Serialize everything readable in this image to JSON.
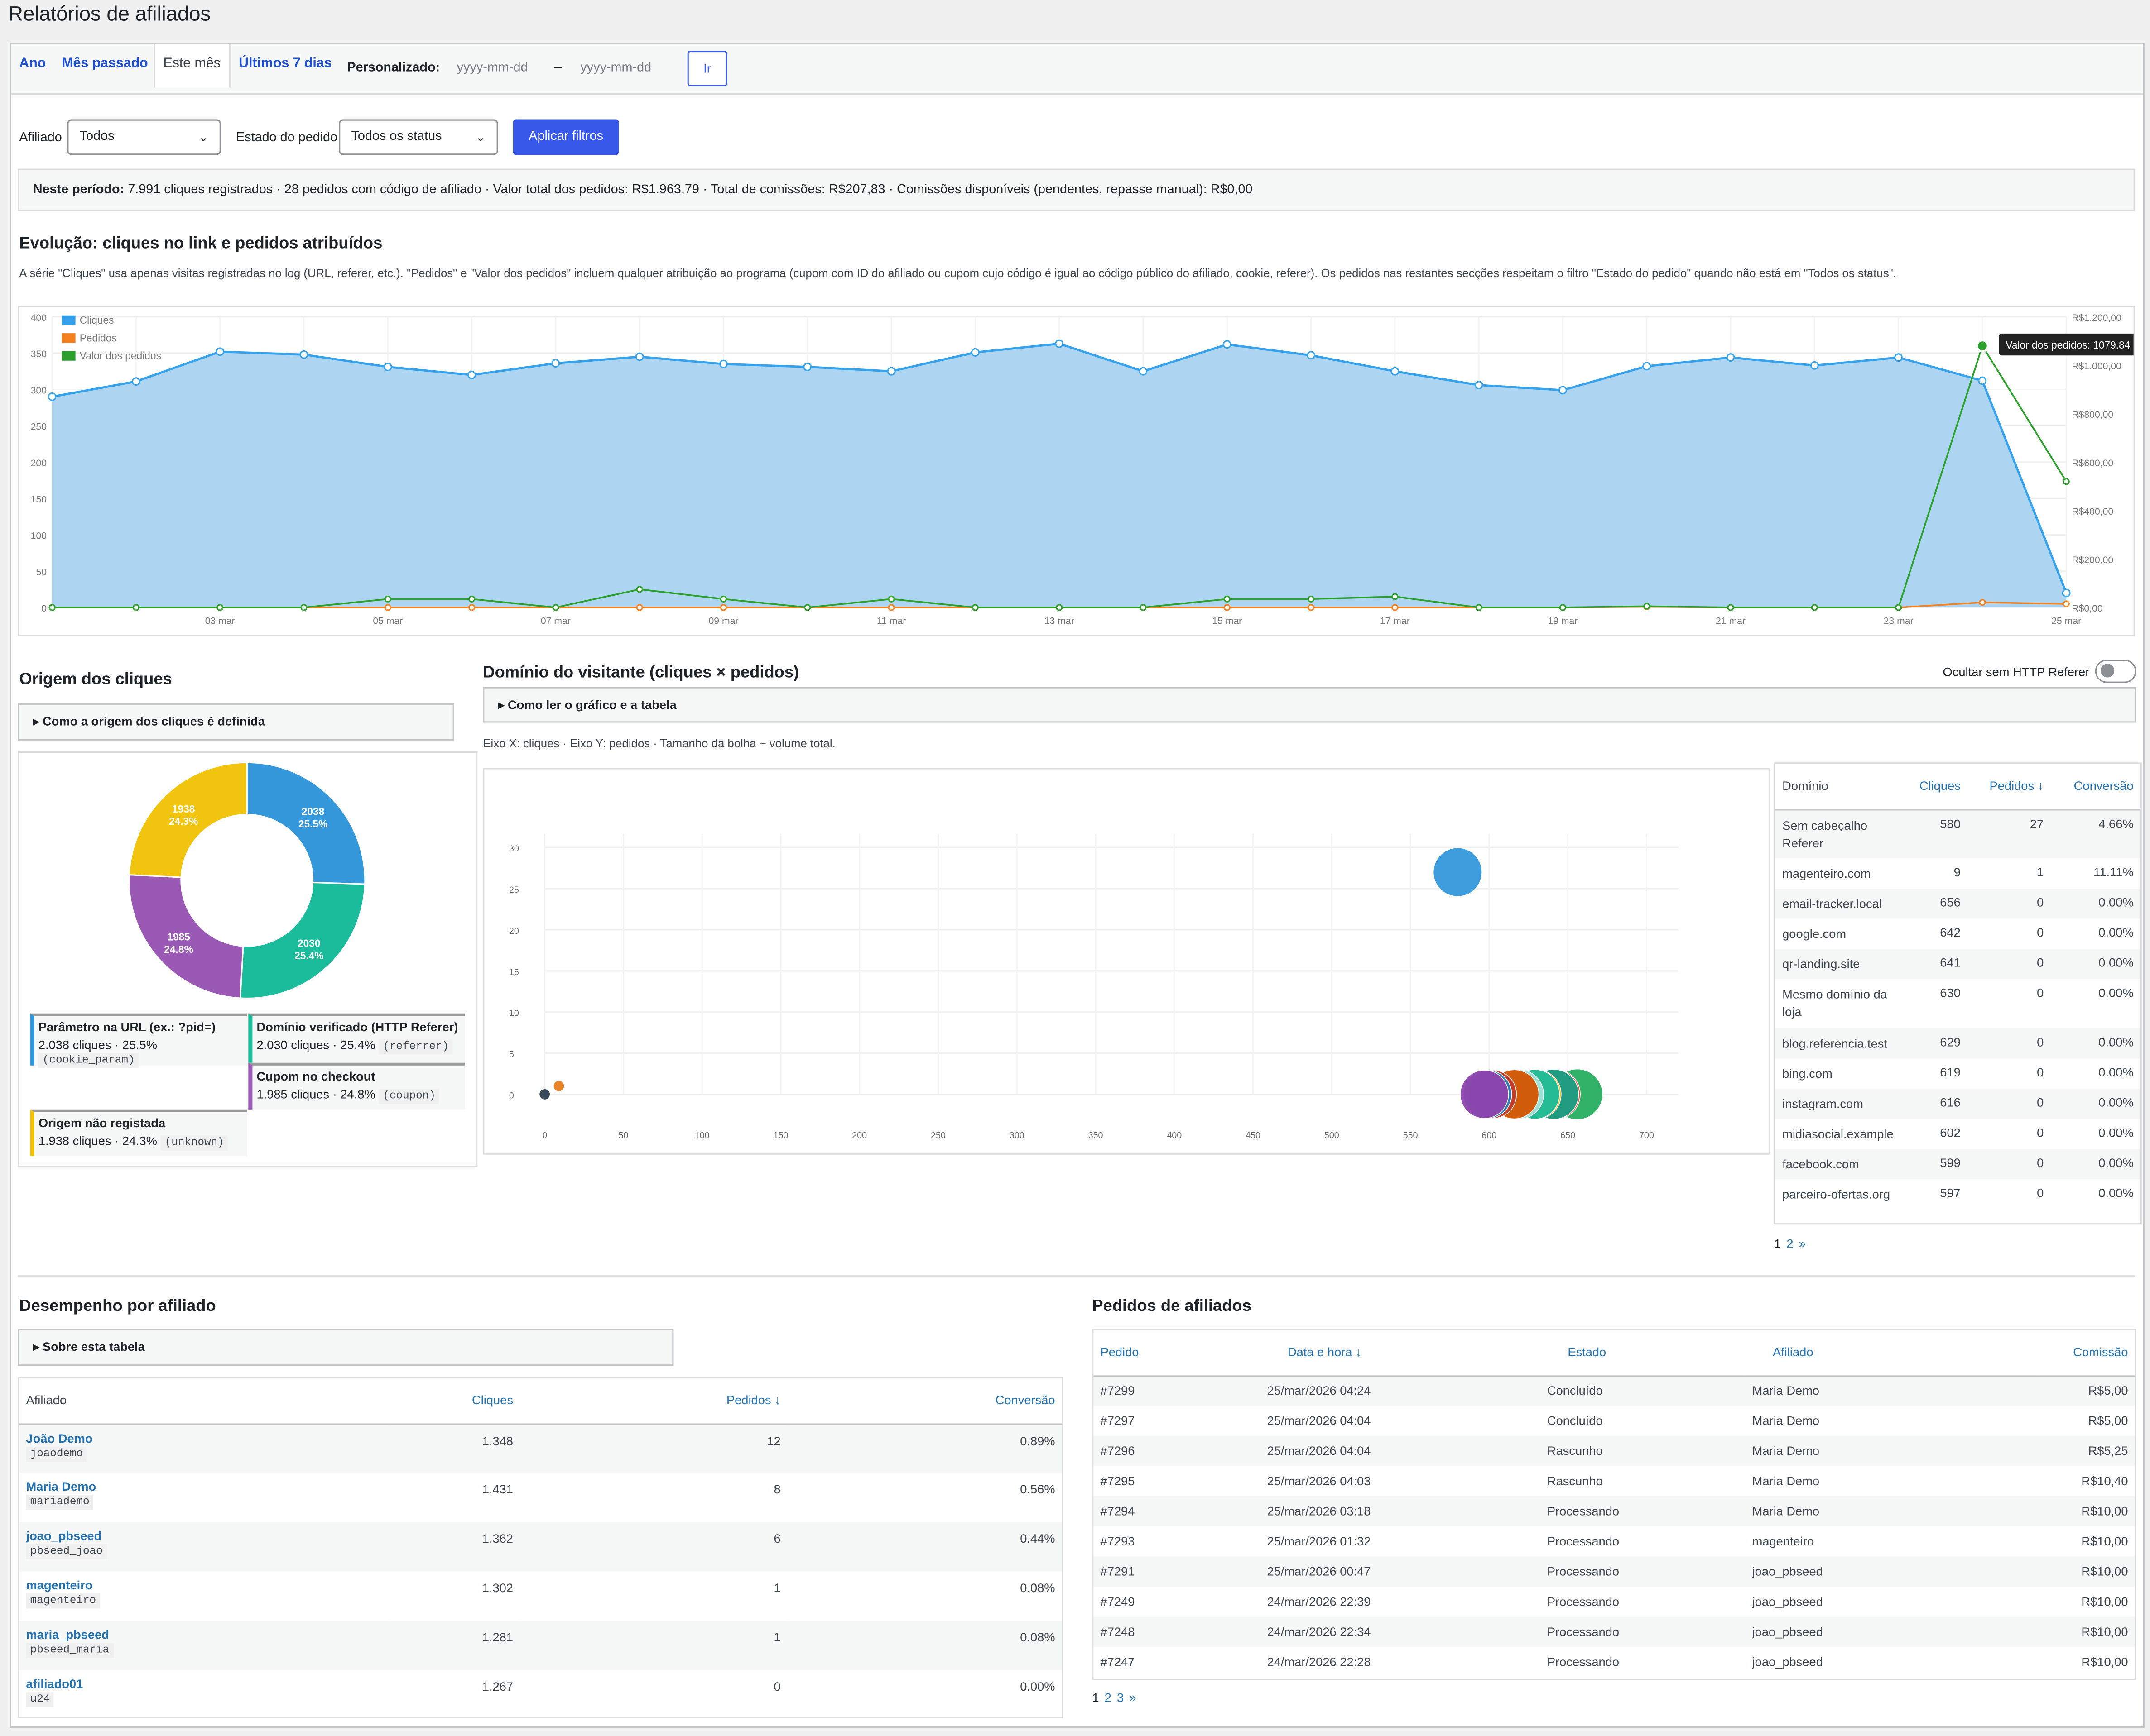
{
  "page": {
    "title": "Relatórios de afiliados"
  },
  "tabs": [
    {
      "label": "Ano"
    },
    {
      "label": "Mês passado"
    },
    {
      "label": "Este mês"
    },
    {
      "label": "Últimos 7 dias"
    }
  ],
  "custom": {
    "label": "Personalizado:",
    "from_placeholder": "yyyy-mm-dd",
    "dash": "–",
    "to_placeholder": "yyyy-mm-dd",
    "go": "Ir"
  },
  "filters": {
    "affiliate_label": "Afiliado",
    "affiliate_value": "Todos",
    "status_label": "Estado do pedido",
    "status_value": "Todos os status",
    "apply": "Aplicar filtros"
  },
  "summary": {
    "lead": "Neste período:",
    "text": "7.991 cliques registrados · 28 pedidos com código de afiliado · Valor total dos pedidos: R$1.963,79 · Total de comissões: R$207,83 · Comissões disponíveis (pendentes, repasse manual): R$0,00"
  },
  "evolution": {
    "title": "Evolução: cliques no link e pedidos atribuídos",
    "description": "A série \"Cliques\" usa apenas visitas registradas no log (URL, referer, etc.). \"Pedidos\" e \"Valor dos pedidos\" incluem qualquer atribuição ao programa (cupom com ID do afiliado ou cupom cujo código é igual ao código público do afiliado, cookie, referer). Os pedidos nas restantes secções respeitam o filtro \"Estado do pedido\" quando não está em \"Todos os status\".",
    "tooltip": "Valor dos pedidos: 1079.84"
  },
  "chart_data": [
    {
      "type": "line",
      "x": [
        "01 mar",
        "02 mar",
        "03 mar",
        "04 mar",
        "05 mar",
        "06 mar",
        "07 mar",
        "08 mar",
        "09 mar",
        "10 mar",
        "11 mar",
        "12 mar",
        "13 mar",
        "14 mar",
        "15 mar",
        "16 mar",
        "17 mar",
        "18 mar",
        "19 mar",
        "20 mar",
        "21 mar",
        "22 mar",
        "23 mar",
        "24 mar",
        "25 mar"
      ],
      "xticks": [
        "03 mar",
        "05 mar",
        "07 mar",
        "09 mar",
        "11 mar",
        "13 mar",
        "15 mar",
        "17 mar",
        "19 mar",
        "21 mar",
        "23 mar",
        "25 mar"
      ],
      "series": [
        {
          "name": "Cliques",
          "axis": "left",
          "color": "#36a2eb",
          "values": [
            290,
            311,
            352,
            348,
            331,
            320,
            336,
            345,
            335,
            331,
            325,
            351,
            363,
            325,
            362,
            347,
            325,
            306,
            299,
            332,
            344,
            333,
            344,
            312,
            20
          ]
        },
        {
          "name": "Pedidos",
          "axis": "left",
          "color": "#f58220",
          "values": [
            0,
            0,
            0,
            0,
            0,
            0,
            0,
            0,
            0,
            0,
            0,
            0,
            0,
            0,
            0,
            0,
            0,
            0,
            0,
            1,
            0,
            0,
            0,
            7,
            5
          ]
        },
        {
          "name": "Valor dos pedidos",
          "axis": "right",
          "color": "#2ca02c",
          "values": [
            0,
            0,
            0,
            0,
            35,
            35,
            0,
            75,
            35,
            0,
            35,
            0,
            0,
            0,
            35,
            35,
            45,
            0,
            0,
            5,
            0,
            0,
            0,
            1079.84,
            520
          ]
        }
      ],
      "yticks_left": [
        0,
        50,
        100,
        150,
        200,
        250,
        300,
        350,
        400
      ],
      "ylim_left": [
        0,
        400
      ],
      "yticks_right": [
        "R$0,00",
        "R$200,00",
        "R$400,00",
        "R$600,00",
        "R$800,00",
        "R$1.000,00",
        "R$1.200,00"
      ],
      "ylim_right": [
        0,
        1200
      ],
      "legend": "top-left"
    },
    {
      "type": "pie",
      "labels": [
        "Parâmetro na URL (ex.: ?pid=)",
        "Domínio verificado (HTTP Referer)",
        "Cupom no checkout",
        "Origem não registada"
      ],
      "values": [
        2038,
        2030,
        1985,
        1938
      ],
      "percents": [
        "25.5%",
        "25.4%",
        "24.8%",
        "24.3%"
      ],
      "colors": [
        "#3498db",
        "#1abc9c",
        "#9b59b6",
        "#f1c40f"
      ]
    },
    {
      "type": "scatter",
      "xlabel": "",
      "ylabel": "",
      "xticks": [
        0,
        50,
        100,
        150,
        200,
        250,
        300,
        350,
        400,
        450,
        500,
        550,
        600,
        650,
        700
      ],
      "yticks": [
        0,
        5,
        10,
        15,
        20,
        25,
        30
      ],
      "points": [
        {
          "x": 580,
          "y": 27,
          "size": 607,
          "color": "#3498db"
        },
        {
          "x": 9,
          "y": 1,
          "size": 10,
          "color": "#e67e22"
        },
        {
          "x": 0,
          "y": 0,
          "size": 2,
          "color": "#2c3e50"
        },
        {
          "x": 656,
          "y": 0,
          "size": 656,
          "color": "#27ae60"
        },
        {
          "x": 642,
          "y": 0,
          "size": 642,
          "color": "#e74c3c"
        },
        {
          "x": 641,
          "y": 0,
          "size": 641,
          "color": "#16a085"
        },
        {
          "x": 630,
          "y": 0,
          "size": 630,
          "color": "#f1c40f"
        },
        {
          "x": 629,
          "y": 0,
          "size": 629,
          "color": "#1abc9c"
        },
        {
          "x": 619,
          "y": 0,
          "size": 619,
          "color": "#a3e4d7"
        },
        {
          "x": 616,
          "y": 0,
          "size": 616,
          "color": "#d35400"
        },
        {
          "x": 602,
          "y": 0,
          "size": 602,
          "color": "#c0392b"
        },
        {
          "x": 599,
          "y": 0,
          "size": 599,
          "color": "#2980b9"
        },
        {
          "x": 597,
          "y": 0,
          "size": 597,
          "color": "#8e44ad"
        }
      ]
    }
  ],
  "origin": {
    "title": "Origem dos cliques",
    "details": "Como a origem dos cliques é definida",
    "cards": [
      {
        "title": "Parâmetro na URL (ex.: ?pid=)",
        "stats": "2.038 cliques · 25.5%",
        "code": "(cookie_param)",
        "color": "#3498db"
      },
      {
        "title": "Domínio verificado (HTTP Referer)",
        "stats": "2.030 cliques · 25.4%",
        "code": "(referrer)",
        "color": "#1abc9c"
      },
      {
        "title": "Cupom no checkout",
        "stats": "1.985 cliques · 24.8%",
        "code": "(coupon)",
        "color": "#9b59b6"
      },
      {
        "title": "Origem não registada",
        "stats": "1.938 cliques · 24.3%",
        "code": "(unknown)",
        "color": "#f1c40f"
      }
    ],
    "pie_labels": [
      {
        "value": "2038",
        "pct": "25.5%"
      },
      {
        "value": "2030",
        "pct": "25.4%"
      },
      {
        "value": "1985",
        "pct": "24.8%"
      },
      {
        "value": "1938",
        "pct": "24.3%"
      }
    ]
  },
  "domain": {
    "title": "Domínio do visitante (cliques × pedidos)",
    "toggle_label": "Ocultar sem HTTP Referer",
    "details": "Como ler o gráfico e a tabela",
    "axis_note": "Eixo X: cliques · Eixo Y: pedidos · Tamanho da bolha ~ volume total.",
    "columns": [
      "Domínio",
      "Cliques",
      "Pedidos ↓",
      "Conversão"
    ],
    "rows": [
      [
        "Sem cabeçalho Referer",
        "580",
        "27",
        "4.66%"
      ],
      [
        "magenteiro.com",
        "9",
        "1",
        "11.11%"
      ],
      [
        "email-tracker.local",
        "656",
        "0",
        "0.00%"
      ],
      [
        "google.com",
        "642",
        "0",
        "0.00%"
      ],
      [
        "qr-landing.site",
        "641",
        "0",
        "0.00%"
      ],
      [
        "Mesmo domínio da loja",
        "630",
        "0",
        "0.00%"
      ],
      [
        "blog.referencia.test",
        "629",
        "0",
        "0.00%"
      ],
      [
        "bing.com",
        "619",
        "0",
        "0.00%"
      ],
      [
        "instagram.com",
        "616",
        "0",
        "0.00%"
      ],
      [
        "midiasocial.example",
        "602",
        "0",
        "0.00%"
      ],
      [
        "facebook.com",
        "599",
        "0",
        "0.00%"
      ],
      [
        "parceiro-ofertas.org",
        "597",
        "0",
        "0.00%"
      ]
    ],
    "pagination": [
      "1",
      "2",
      "»"
    ]
  },
  "performance": {
    "title": "Desempenho por afiliado",
    "details": "Sobre esta tabela",
    "columns": [
      "Afiliado",
      "Cliques",
      "Pedidos ↓",
      "Conversão"
    ],
    "rows": [
      {
        "name": "João Demo",
        "code": "joaodemo",
        "clicks": "1.348",
        "orders": "12",
        "conv": "0.89%"
      },
      {
        "name": "Maria Demo",
        "code": "mariademo",
        "clicks": "1.431",
        "orders": "8",
        "conv": "0.56%"
      },
      {
        "name": "joao_pbseed",
        "code": "pbseed_joao",
        "clicks": "1.362",
        "orders": "6",
        "conv": "0.44%"
      },
      {
        "name": "magenteiro",
        "code": "magenteiro",
        "clicks": "1.302",
        "orders": "1",
        "conv": "0.08%"
      },
      {
        "name": "maria_pbseed",
        "code": "pbseed_maria",
        "clicks": "1.281",
        "orders": "1",
        "conv": "0.08%"
      },
      {
        "name": "afiliado01",
        "code": "u24",
        "clicks": "1.267",
        "orders": "0",
        "conv": "0.00%"
      }
    ]
  },
  "orders": {
    "title": "Pedidos de afiliados",
    "columns": [
      "Pedido",
      "Data e hora ↓",
      "Estado",
      "Afiliado",
      "Comissão"
    ],
    "rows": [
      [
        "#7299",
        "25/mar/2026 04:24",
        "Concluído",
        "Maria Demo",
        "R$5,00"
      ],
      [
        "#7297",
        "25/mar/2026 04:04",
        "Concluído",
        "Maria Demo",
        "R$5,00"
      ],
      [
        "#7296",
        "25/mar/2026 04:04",
        "Rascunho",
        "Maria Demo",
        "R$5,25"
      ],
      [
        "#7295",
        "25/mar/2026 04:03",
        "Rascunho",
        "Maria Demo",
        "R$10,40"
      ],
      [
        "#7294",
        "25/mar/2026 03:18",
        "Processando",
        "Maria Demo",
        "R$10,00"
      ],
      [
        "#7293",
        "25/mar/2026 01:32",
        "Processando",
        "magenteiro",
        "R$10,00"
      ],
      [
        "#7291",
        "25/mar/2026 00:47",
        "Processando",
        "joao_pbseed",
        "R$10,00"
      ],
      [
        "#7249",
        "24/mar/2026 22:39",
        "Processando",
        "joao_pbseed",
        "R$10,00"
      ],
      [
        "#7248",
        "24/mar/2026 22:34",
        "Processando",
        "joao_pbseed",
        "R$10,00"
      ],
      [
        "#7247",
        "24/mar/2026 22:28",
        "Processando",
        "joao_pbseed",
        "R$10,00"
      ]
    ],
    "pagination": [
      "1",
      "2",
      "3",
      "»"
    ]
  }
}
